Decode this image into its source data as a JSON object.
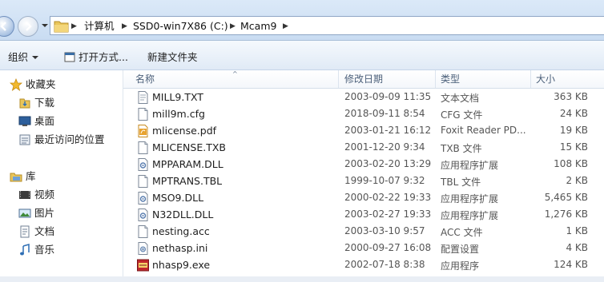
{
  "address": {
    "crumbs": [
      "计算机",
      "SSD0-win7X86 (C:)",
      "Mcam9"
    ]
  },
  "toolbar": {
    "organize": "组织",
    "open_with": "打开方式...",
    "new_folder": "新建文件夹"
  },
  "nav": {
    "favorites_header": "收藏夹",
    "favorites": [
      "下载",
      "桌面",
      "最近访问的位置"
    ],
    "libraries_header": "库",
    "libraries": [
      "视频",
      "图片",
      "文档",
      "音乐"
    ]
  },
  "columns": {
    "name": "名称",
    "date": "修改日期",
    "type": "类型",
    "size": "大小"
  },
  "files": [
    {
      "name": "MILL9.TXT",
      "date": "2003-09-09 11:35",
      "type": "文本文档",
      "size": "363 KB",
      "icon": "text-file-icon"
    },
    {
      "name": "mill9m.cfg",
      "date": "2018-09-11 8:54",
      "type": "CFG 文件",
      "size": "24 KB",
      "icon": "generic-file-icon"
    },
    {
      "name": "mlicense.pdf",
      "date": "2003-01-21 16:12",
      "type": "Foxit Reader PD...",
      "size": "19 KB",
      "icon": "pdf-file-icon"
    },
    {
      "name": "MLICENSE.TXB",
      "date": "2001-12-20 9:34",
      "type": "TXB 文件",
      "size": "15 KB",
      "icon": "generic-file-icon"
    },
    {
      "name": "MPPARAM.DLL",
      "date": "2003-02-20 13:29",
      "type": "应用程序扩展",
      "size": "108 KB",
      "icon": "dll-file-icon"
    },
    {
      "name": "MPTRANS.TBL",
      "date": "1999-10-07 9:32",
      "type": "TBL 文件",
      "size": "2 KB",
      "icon": "generic-file-icon"
    },
    {
      "name": "MSO9.DLL",
      "date": "2000-02-22 19:33",
      "type": "应用程序扩展",
      "size": "5,465 KB",
      "icon": "dll-file-icon"
    },
    {
      "name": "N32DLL.DLL",
      "date": "2003-02-27 19:33",
      "type": "应用程序扩展",
      "size": "1,276 KB",
      "icon": "dll-file-icon"
    },
    {
      "name": "nesting.acc",
      "date": "2003-03-10 9:57",
      "type": "ACC 文件",
      "size": "1 KB",
      "icon": "generic-file-icon"
    },
    {
      "name": "nethasp.ini",
      "date": "2000-09-27 16:08",
      "type": "配置设置",
      "size": "4 KB",
      "icon": "ini-file-icon"
    },
    {
      "name": "nhasp9.exe",
      "date": "2002-07-18 8:38",
      "type": "应用程序",
      "size": "124 KB",
      "icon": "exe-file-icon"
    }
  ],
  "colors": {
    "accent": "#3a6ea5",
    "pdf": "#e8a330",
    "exe": "#c0282d"
  }
}
